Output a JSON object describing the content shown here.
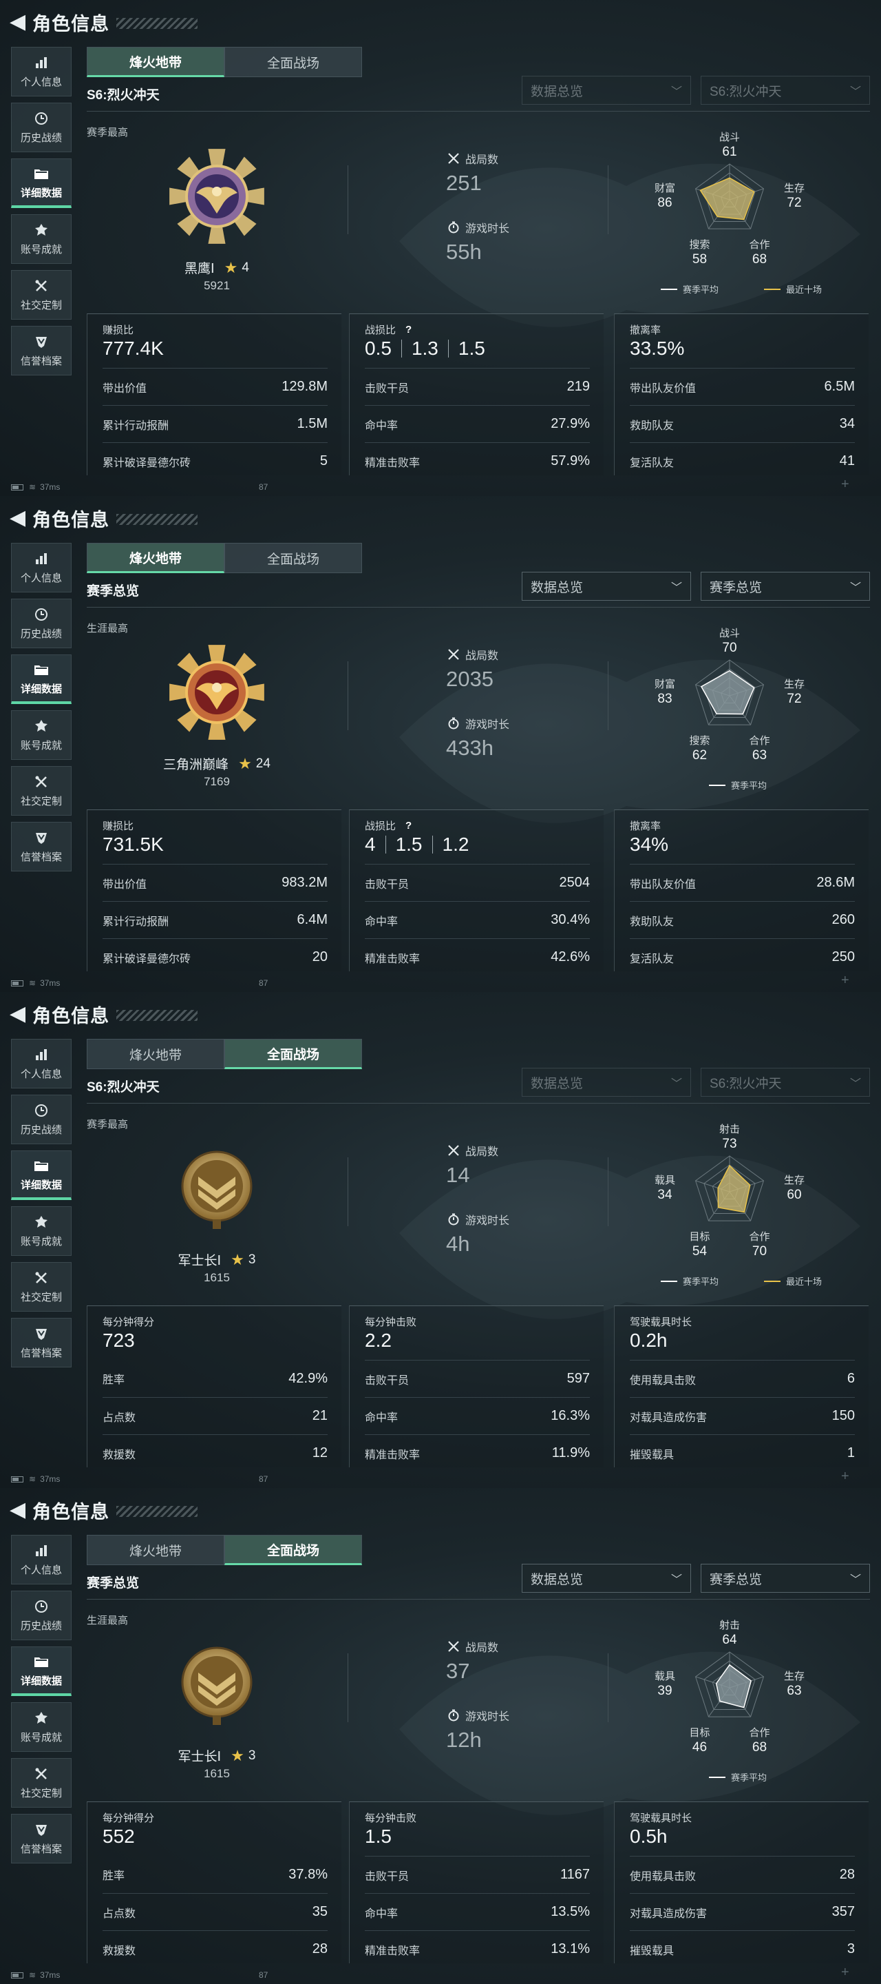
{
  "header": {
    "title": "角色信息"
  },
  "sidebar": [
    {
      "label": "个人信息",
      "icon": "bar-chart-icon"
    },
    {
      "label": "历史战绩",
      "icon": "clock-icon"
    },
    {
      "label": "详细数据",
      "icon": "folder-icon",
      "active": true
    },
    {
      "label": "账号成就",
      "icon": "medal-icon"
    },
    {
      "label": "社交定制",
      "icon": "tools-icon"
    },
    {
      "label": "信誉档案",
      "icon": "shield-icon"
    }
  ],
  "tabs": [
    "烽火地带",
    "全面战场"
  ],
  "colors": {
    "accent": "#5ed6a6",
    "radar_fill": "#c9b873",
    "recent_line": "#e8c24a"
  },
  "panels": [
    {
      "active_tab": 0,
      "subtitle": "S6:烈火冲天",
      "dropdowns_dim": true,
      "dropdown1": "数据总览",
      "dropdown2": "S6:烈火冲天",
      "best_label": "赛季最高",
      "badge": "eagle-medal",
      "rank_name": "黑鹰Ⅰ",
      "rank_stars": "4",
      "rank_points": "5921",
      "stat1": {
        "label": "战局数",
        "value": "251"
      },
      "stat2": {
        "label": "游戏时长",
        "value": "55h"
      },
      "radar": {
        "labels": [
          "战斗",
          "生存",
          "合作",
          "搜索",
          "财富"
        ],
        "values": [
          61,
          72,
          68,
          58,
          86
        ],
        "recent": true
      },
      "legend": [
        "赛季平均",
        "最近十场"
      ],
      "cards": [
        {
          "header": "赚损比",
          "big": [
            "777.4K"
          ],
          "rows": [
            [
              "带出价值",
              "129.8M"
            ],
            [
              "累计行动报酬",
              "1.5M"
            ],
            [
              "累计破译曼德尔砖",
              "5"
            ]
          ]
        },
        {
          "header": "战损比",
          "help": "?",
          "big": [
            "0.5",
            "1.3",
            "1.5"
          ],
          "rows": [
            [
              "击败干员",
              "219"
            ],
            [
              "命中率",
              "27.9%"
            ],
            [
              "精准击败率",
              "57.9%"
            ]
          ]
        },
        {
          "header": "撤离率",
          "big": [
            "33.5%"
          ],
          "rows": [
            [
              "带出队友价值",
              "6.5M"
            ],
            [
              "救助队友",
              "34"
            ],
            [
              "复活队友",
              "41"
            ]
          ]
        }
      ],
      "status": {
        "ping": "37ms",
        "fps": "87"
      }
    },
    {
      "active_tab": 0,
      "subtitle": "赛季总览",
      "dropdowns_dim": false,
      "dropdown1": "数据总览",
      "dropdown2": "赛季总览",
      "best_label": "生涯最高",
      "badge": "delta-medal",
      "rank_name": "三角洲巅峰",
      "rank_stars": "24",
      "rank_points": "7169",
      "stat1": {
        "label": "战局数",
        "value": "2035"
      },
      "stat2": {
        "label": "游戏时长",
        "value": "433h"
      },
      "radar": {
        "labels": [
          "战斗",
          "生存",
          "合作",
          "搜索",
          "财富"
        ],
        "values": [
          70,
          72,
          63,
          62,
          83
        ],
        "recent": false
      },
      "legend": [
        "赛季平均"
      ],
      "cards": [
        {
          "header": "赚损比",
          "big": [
            "731.5K"
          ],
          "rows": [
            [
              "带出价值",
              "983.2M"
            ],
            [
              "累计行动报酬",
              "6.4M"
            ],
            [
              "累计破译曼德尔砖",
              "20"
            ]
          ]
        },
        {
          "header": "战损比",
          "help": "?",
          "big": [
            "4",
            "1.5",
            "1.2"
          ],
          "rows": [
            [
              "击败干员",
              "2504"
            ],
            [
              "命中率",
              "30.4%"
            ],
            [
              "精准击败率",
              "42.6%"
            ]
          ]
        },
        {
          "header": "撤离率",
          "big": [
            "34%"
          ],
          "rows": [
            [
              "带出队友价值",
              "28.6M"
            ],
            [
              "救助队友",
              "260"
            ],
            [
              "复活队友",
              "250"
            ]
          ]
        }
      ],
      "status": {
        "ping": "37ms",
        "fps": "87"
      }
    },
    {
      "active_tab": 1,
      "subtitle": "S6:烈火冲天",
      "dropdowns_dim": true,
      "dropdown1": "数据总览",
      "dropdown2": "S6:烈火冲天",
      "best_label": "赛季最高",
      "badge": "chevron-badge",
      "rank_name": "军士长Ⅰ",
      "rank_stars": "3",
      "rank_points": "1615",
      "stat1": {
        "label": "战局数",
        "value": "14"
      },
      "stat2": {
        "label": "游戏时长",
        "value": "4h"
      },
      "radar": {
        "labels": [
          "射击",
          "生存",
          "合作",
          "目标",
          "载具"
        ],
        "values": [
          73,
          60,
          70,
          54,
          34
        ],
        "recent": true
      },
      "legend": [
        "赛季平均",
        "最近十场"
      ],
      "cards": [
        {
          "header": "每分钟得分",
          "big": [
            "723"
          ],
          "rows": [
            [
              "胜率",
              "42.9%"
            ],
            [
              "占点数",
              "21"
            ],
            [
              "救援数",
              "12"
            ]
          ]
        },
        {
          "header": "每分钟击败",
          "big": [
            "2.2"
          ],
          "rows": [
            [
              "击败干员",
              "597"
            ],
            [
              "命中率",
              "16.3%"
            ],
            [
              "精准击败率",
              "11.9%"
            ]
          ]
        },
        {
          "header": "驾驶载具时长",
          "big": [
            "0.2h"
          ],
          "rows": [
            [
              "使用载具击败",
              "6"
            ],
            [
              "对载具造成伤害",
              "150"
            ],
            [
              "摧毁载具",
              "1"
            ]
          ]
        }
      ],
      "status": {
        "ping": "37ms",
        "fps": "87"
      }
    },
    {
      "active_tab": 1,
      "subtitle": "赛季总览",
      "dropdowns_dim": false,
      "dropdown1": "数据总览",
      "dropdown2": "赛季总览",
      "best_label": "生涯最高",
      "badge": "chevron-badge",
      "rank_name": "军士长Ⅰ",
      "rank_stars": "3",
      "rank_points": "1615",
      "stat1": {
        "label": "战局数",
        "value": "37"
      },
      "stat2": {
        "label": "游戏时长",
        "value": "12h"
      },
      "radar": {
        "labels": [
          "射击",
          "生存",
          "合作",
          "目标",
          "载具"
        ],
        "values": [
          64,
          63,
          68,
          46,
          39
        ],
        "recent": false
      },
      "legend": [
        "赛季平均"
      ],
      "cards": [
        {
          "header": "每分钟得分",
          "big": [
            "552"
          ],
          "rows": [
            [
              "胜率",
              "37.8%"
            ],
            [
              "占点数",
              "35"
            ],
            [
              "救援数",
              "28"
            ]
          ]
        },
        {
          "header": "每分钟击败",
          "big": [
            "1.5"
          ],
          "rows": [
            [
              "击败干员",
              "1167"
            ],
            [
              "命中率",
              "13.5%"
            ],
            [
              "精准击败率",
              "13.1%"
            ]
          ]
        },
        {
          "header": "驾驶载具时长",
          "big": [
            "0.5h"
          ],
          "rows": [
            [
              "使用载具击败",
              "28"
            ],
            [
              "对载具造成伤害",
              "357"
            ],
            [
              "摧毁载具",
              "3"
            ]
          ]
        }
      ],
      "status": {
        "ping": "37ms",
        "fps": "87"
      }
    }
  ]
}
